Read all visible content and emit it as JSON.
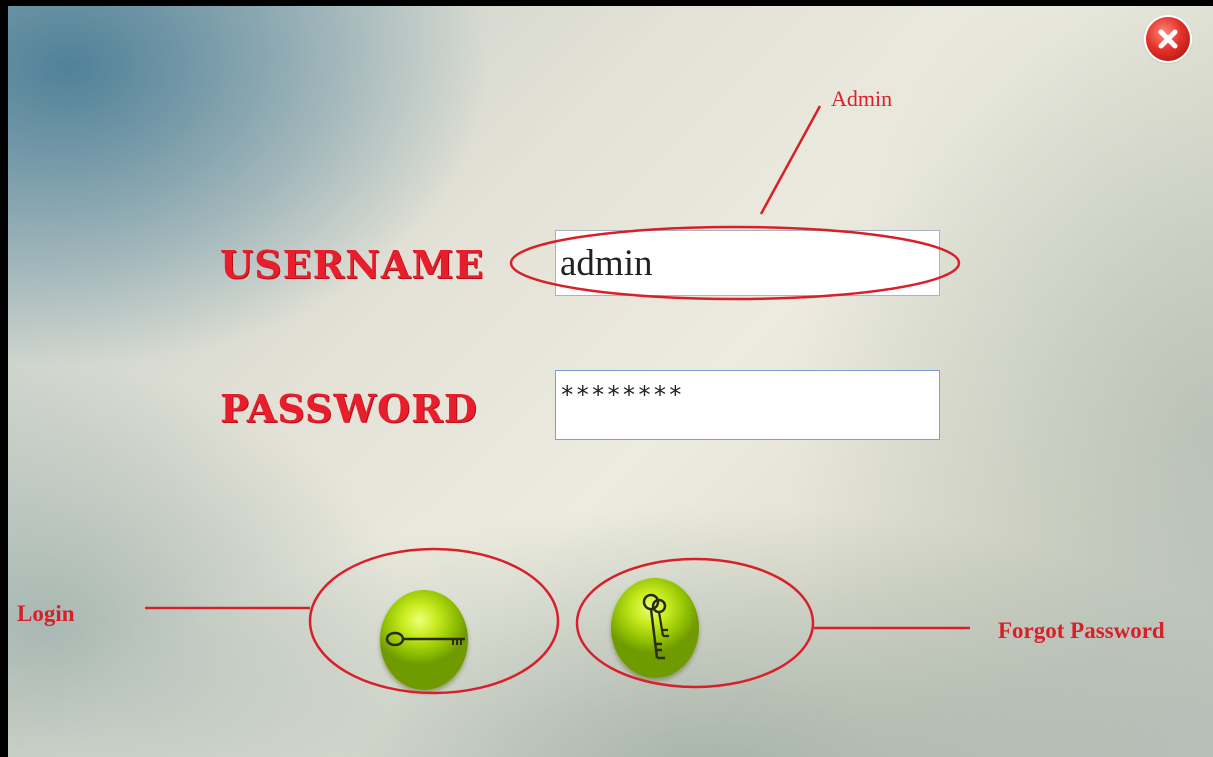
{
  "form": {
    "username_label": "USERNAME",
    "password_label": "PASSWORD",
    "username_value": "admin",
    "password_value": "********"
  },
  "annotations": {
    "admin": "Admin",
    "login": "Login",
    "forgot_password": "Forgot Password"
  },
  "icons": {
    "close": "close-icon",
    "login": "key-icon",
    "forgot": "vintage-keys-icon"
  },
  "colors": {
    "label_red": "#e81e2c",
    "annotation_red": "#d8202a",
    "orb_green": "#c8ec20"
  }
}
